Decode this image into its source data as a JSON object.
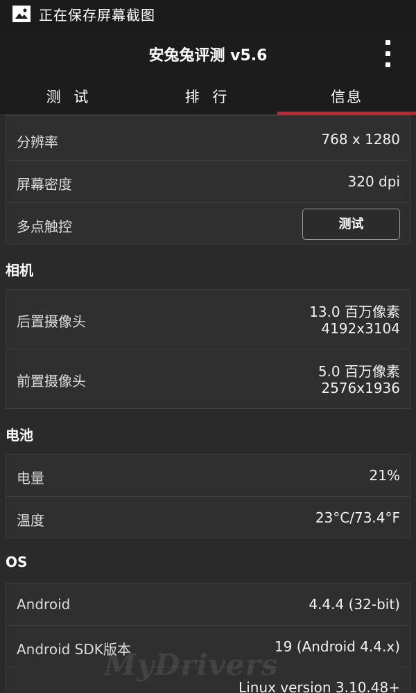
{
  "status_bar": {
    "icon": "image-icon",
    "text": "正在保存屏幕截图"
  },
  "app_bar": {
    "title": "安兔兔评测 v5.6",
    "overflow_icon": "more-vertical-icon"
  },
  "tabs": [
    {
      "label": "测 试",
      "selected": false
    },
    {
      "label": "排 行",
      "selected": false
    },
    {
      "label": "信息",
      "selected": true
    }
  ],
  "colors": {
    "accent": "#c8232c",
    "background": "#2a2a2a",
    "card": "#2f2f2f",
    "bar": "#1c1c1c"
  },
  "display": {
    "resolution_label": "分辨率",
    "resolution_value": "768 x 1280",
    "density_label": "屏幕密度",
    "density_value": "320 dpi",
    "multitouch_label": "多点触控",
    "multitouch_button": "测试"
  },
  "camera": {
    "title": "相机",
    "rear_label": "后置摄像头",
    "rear_mp": "13.0 百万像素",
    "rear_res": "4192x3104",
    "front_label": "前置摄像头",
    "front_mp": "5.0 百万像素",
    "front_res": "2576x1936"
  },
  "battery": {
    "title": "电池",
    "level_label": "电量",
    "level_value": "21%",
    "temp_label": "温度",
    "temp_value": "23°C/73.4°F"
  },
  "os": {
    "title": "OS",
    "android_label": "Android",
    "android_value": "4.4.4 (32-bit)",
    "sdk_label": "Android SDK版本",
    "sdk_value": "19  (Android 4.4.x)",
    "linux_value": "Linux version 3.10.48+"
  },
  "watermark": "MyDrivers"
}
